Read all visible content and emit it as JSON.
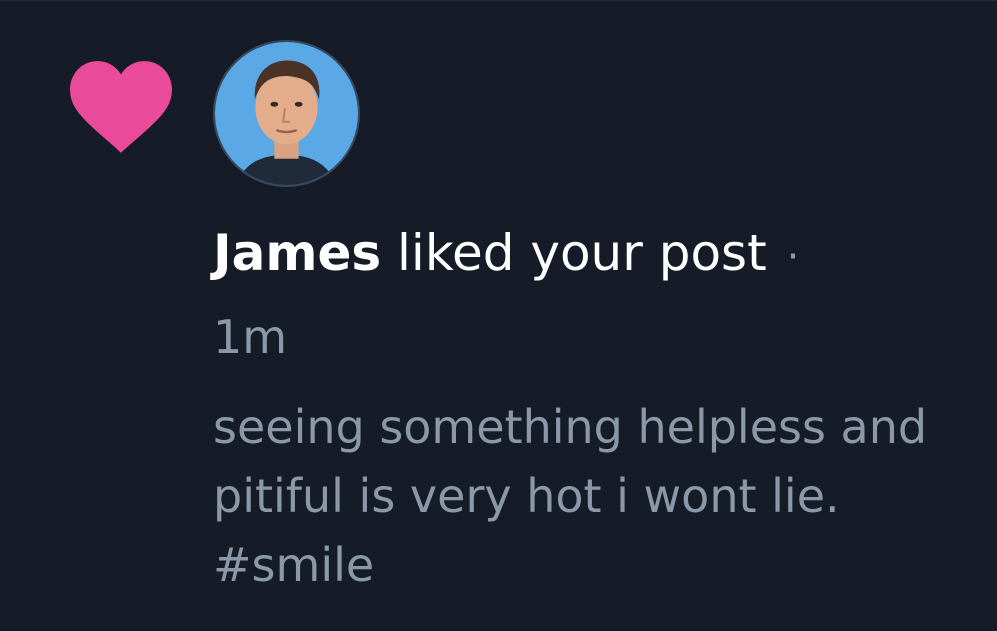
{
  "notification": {
    "type_icon": "heart-icon",
    "actor_name": "James",
    "action_text": "liked your post",
    "separator": "·",
    "timestamp": "1m",
    "post_text": "seeing something helpless and pitiful is very hot i wont lie. #smile",
    "avatar_icon": "user-avatar"
  },
  "colors": {
    "background": "#161c27",
    "heart": "#e94a9a",
    "primary_text": "#ffffff",
    "secondary_text": "#8b98a8",
    "avatar_background": "#5aa9e6"
  }
}
